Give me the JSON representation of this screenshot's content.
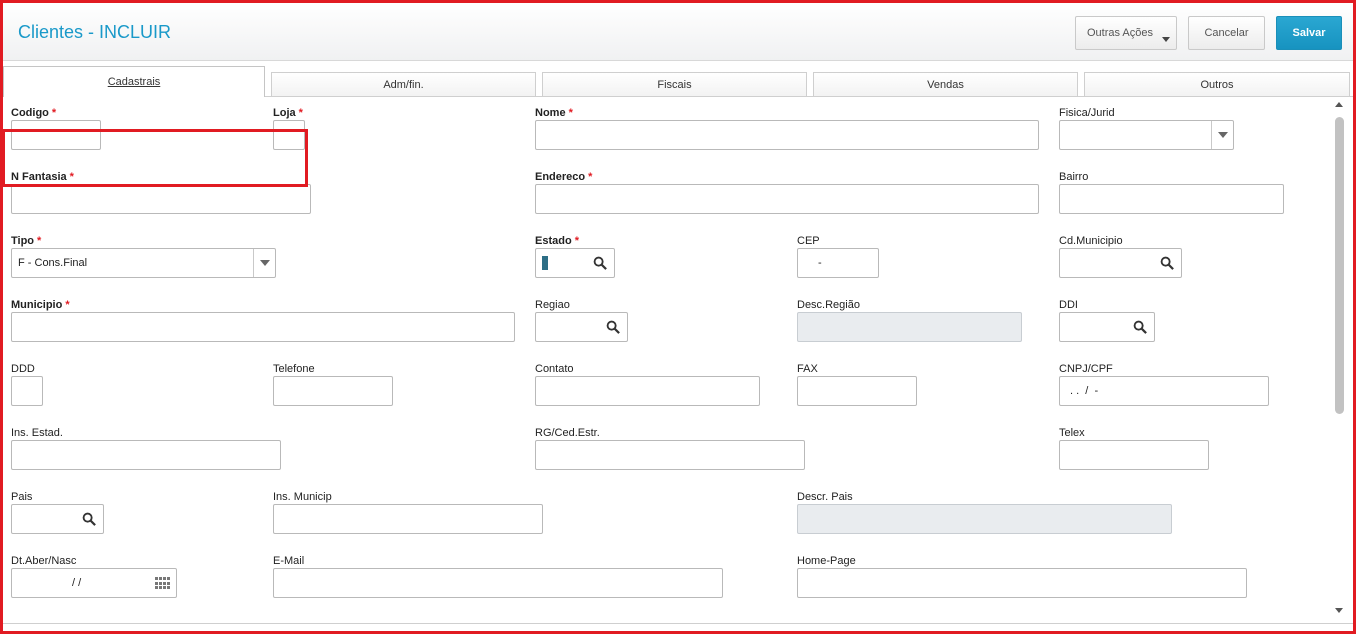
{
  "header": {
    "title": "Clientes - INCLUIR",
    "outras_acoes": "Outras Ações",
    "cancelar": "Cancelar",
    "salvar": "Salvar"
  },
  "tabs": [
    {
      "label": "Cadastrais",
      "active": true
    },
    {
      "label": "Adm/fin."
    },
    {
      "label": "Fiscais"
    },
    {
      "label": "Vendas"
    },
    {
      "label": "Outros"
    }
  ],
  "fields": {
    "codigo": {
      "label": "Codigo",
      "required": true,
      "value": ""
    },
    "loja": {
      "label": "Loja",
      "required": true,
      "value": ""
    },
    "nome": {
      "label": "Nome",
      "required": true,
      "value": ""
    },
    "fisica_jurid": {
      "label": "Fisica/Jurid",
      "value": ""
    },
    "n_fantasia": {
      "label": "N Fantasia",
      "required": true,
      "value": ""
    },
    "endereco": {
      "label": "Endereco",
      "required": true,
      "value": ""
    },
    "bairro": {
      "label": "Bairro",
      "value": ""
    },
    "tipo": {
      "label": "Tipo",
      "required": true,
      "value": "F - Cons.Final"
    },
    "estado": {
      "label": "Estado",
      "required": true,
      "value": ""
    },
    "cep": {
      "label": "CEP",
      "value": "-"
    },
    "cd_municipio": {
      "label": "Cd.Municipio",
      "value": ""
    },
    "municipio": {
      "label": "Municipio",
      "required": true,
      "value": ""
    },
    "regiao": {
      "label": "Regiao",
      "value": ""
    },
    "desc_regiao": {
      "label": "Desc.Região",
      "value": ""
    },
    "ddi": {
      "label": "DDI",
      "value": ""
    },
    "ddd": {
      "label": "DDD",
      "value": ""
    },
    "telefone": {
      "label": "Telefone",
      "value": ""
    },
    "contato": {
      "label": "Contato",
      "value": ""
    },
    "fax": {
      "label": "FAX",
      "value": ""
    },
    "cnpj_cpf": {
      "label": "CNPJ/CPF",
      "value": ". .  /  -"
    },
    "ins_estad": {
      "label": "Ins. Estad.",
      "value": ""
    },
    "rg_ced_estr": {
      "label": "RG/Ced.Estr.",
      "value": ""
    },
    "telex": {
      "label": "Telex",
      "value": ""
    },
    "pais": {
      "label": "Pais",
      "value": ""
    },
    "ins_municip": {
      "label": "Ins. Municip",
      "value": ""
    },
    "descr_pais": {
      "label": "Descr. Pais",
      "value": ""
    },
    "dt_aber_nasc": {
      "label": "Dt.Aber/Nasc",
      "value": "/ /"
    },
    "email": {
      "label": "E-Mail",
      "value": ""
    },
    "home_page": {
      "label": "Home-Page",
      "value": ""
    }
  },
  "colors": {
    "accent": "#1999c9",
    "required_star": "#e11b22",
    "highlight_border": "#e11b22",
    "primary_button": "#1793c0"
  },
  "icons": [
    "search-icon",
    "chevron-down-icon",
    "calendar-icon",
    "scroll-up-icon",
    "scroll-down-icon"
  ]
}
